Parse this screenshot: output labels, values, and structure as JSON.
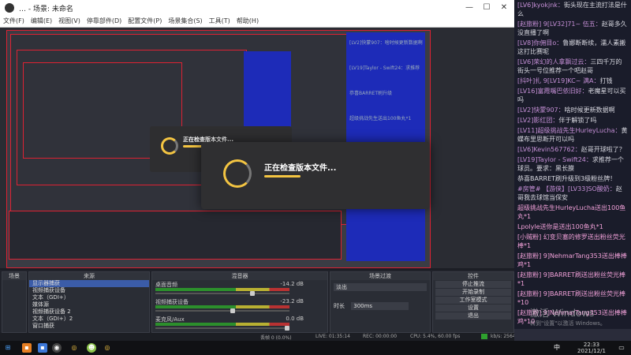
{
  "window": {
    "title": "… - 场景: 未命名",
    "minimize": "—",
    "maximize": "☐",
    "close": "✕"
  },
  "menu": [
    "文件(F)",
    "编辑(E)",
    "视图(V)",
    "停靠部件(D)",
    "配置文件(P)",
    "场景集合(S)",
    "工具(T)",
    "帮助(H)"
  ],
  "splash_small": {
    "text": "正在检查版本文件..."
  },
  "splash_big": {
    "text": "正在检查版本文件..."
  },
  "docks": {
    "scenes": {
      "title": "场景"
    },
    "sources": {
      "title": "来源",
      "items": [
        "显示器捕获",
        "视频捕获设备",
        "文本（GDI+）",
        "媒体源",
        "视频捕获设备 2",
        "文本（GDI+）2",
        "窗口捕获"
      ]
    },
    "mixer": {
      "title": "混音器",
      "rows": [
        {
          "label": "桌面音频",
          "db": "-14.2 dB"
        },
        {
          "label": "视频捕获设备",
          "db": "-23.2 dB"
        },
        {
          "label": "麦克风/Aux",
          "db": "0.0 dB"
        }
      ]
    },
    "transitions": {
      "title": "场景过渡",
      "type": "淡出",
      "duration_label": "时长",
      "duration": "300ms"
    },
    "controls": {
      "title": "控件",
      "buttons": [
        "停止推流",
        "开始录制",
        "工作室模式",
        "设置",
        "退出"
      ]
    }
  },
  "status": {
    "dropped": "丢帧 0 (0.0%)",
    "live": "LIVE: 01:35:14",
    "rec": "REC: 00:00:00",
    "cpu": "CPU: 5.4%, 60.00 fps",
    "kbps": "kb/s: 2564"
  },
  "taskbar": {
    "time": "22:33",
    "date": "2021/12/1",
    "lang": "中"
  },
  "watermark": {
    "line1": "激活 Windows",
    "line2": "转到\"设置\"以激活 Windows。"
  },
  "chat": [
    {
      "user": "[LV6]kyokjnk：",
      "text": "街头现在主流打法是什么",
      "cls": ""
    },
    {
      "user": "[赵旅粉] 9[LV32]71~ 伍五：",
      "text": "赵哥多久没直播了啊",
      "cls": ""
    },
    {
      "user": "[LV8]你佣目o：",
      "text": "鲁娜断断续，濡人素搬这打比赛呢",
      "cls": ""
    },
    {
      "user": "[LV6]荣幻的人拿飘过云：",
      "text": "三四千万的街头一号位推荐一个吧赵哥",
      "cls": ""
    },
    {
      "user": "[抖叶]扎 9[LV19]KC~ 满A：",
      "text": "打钱",
      "cls": ""
    },
    {
      "user": "[LV16]富霞嘴巴依旧好：",
      "text": "老魔星可以买吗",
      "cls": ""
    },
    {
      "user": "[LV2]快蒙907：",
      "text": "啥时候更新数据啊",
      "cls": ""
    },
    {
      "user": "[LV2]影红团：",
      "text": "伴于解锁了吗",
      "cls": ""
    },
    {
      "user": "[LV11]超级挑战先生HurleyLucha：",
      "text": "黄蝶布里思断开可以吗",
      "cls": ""
    },
    {
      "user": "[LV6]Kevin567762：",
      "text": "赵哥开球啦了？",
      "cls": ""
    },
    {
      "user": "[LV19]Taylor - Swift24：",
      "text": "求推荐一个球员。要求：黑长膜",
      "cls": ""
    },
    {
      "user": "",
      "text": "恭喜BARRET刷升级到3级粉丝牌！",
      "cls": ""
    },
    {
      "user": "#房管# 【游侠】[LV33]SO酸奶：",
      "text": "赵哥我去球馆当保安",
      "cls": ""
    },
    {
      "user": "",
      "text": "超级挑战先生HurleyLucha送出100鱼丸*1",
      "cls": "gift"
    },
    {
      "user": "",
      "text": "Lpolyle送你是送出100鱼丸*1",
      "cls": "gift"
    },
    {
      "user": "",
      "text": "[小贼粉] 幻变贝塞的修罗送出粉丝荧光棒*1",
      "cls": "gift"
    },
    {
      "user": "",
      "text": "[赵旅粉] 9]NehmarTang353送出棒棒鸡*1",
      "cls": "gift"
    },
    {
      "user": "",
      "text": "[赵旅粉] 9]BARRET刷送出粉丝荧光棒*1",
      "cls": "gift"
    },
    {
      "user": "",
      "text": "[赵旅粉] 9]BARRET刷送出粉丝荧光棒*10",
      "cls": "gift"
    },
    {
      "user": "",
      "text": "[赵旅粉] 9]NehmarTang353送出棒棒鸡*10",
      "cls": "gift"
    }
  ],
  "nested_chat": [
    "[LV2]快蒙907：啥时候更新数据啊",
    "[LV19]Taylor - Swift24：求推荐",
    "恭喜BARRET刷升级",
    "超级挑战先生送出100鱼丸*1"
  ]
}
